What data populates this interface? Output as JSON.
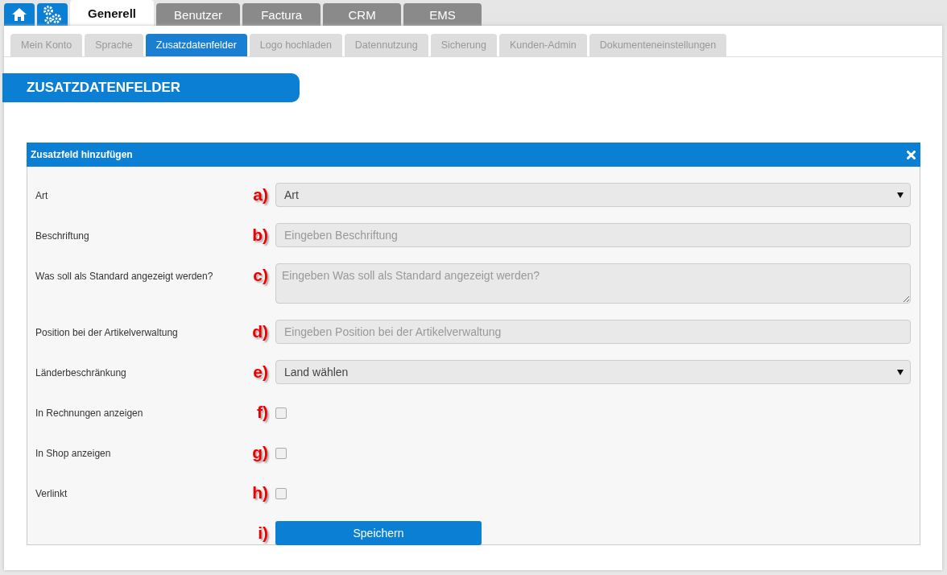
{
  "main_tabs": [
    {
      "kind": "home",
      "selected": false
    },
    {
      "kind": "settings",
      "selected": false
    },
    {
      "kind": "text",
      "label": "Generell",
      "selected": true
    },
    {
      "kind": "text",
      "label": "Benutzer",
      "selected": false
    },
    {
      "kind": "text",
      "label": "Factura",
      "selected": false
    },
    {
      "kind": "text",
      "label": "CRM",
      "selected": false
    },
    {
      "kind": "text",
      "label": "EMS",
      "selected": false
    }
  ],
  "sub_tabs": [
    {
      "label": "Mein Konto",
      "selected": false
    },
    {
      "label": "Sprache",
      "selected": false
    },
    {
      "label": "Zusatzdatenfelder",
      "selected": true
    },
    {
      "label": "Logo hochladen",
      "selected": false
    },
    {
      "label": "Datennutzung",
      "selected": false
    },
    {
      "label": "Sicherung",
      "selected": false
    },
    {
      "label": "Kunden-Admin",
      "selected": false
    },
    {
      "label": "Dokumenteneinstellungen",
      "selected": false
    }
  ],
  "section_title": "ZUSATZDATENFELDER",
  "dialog": {
    "title": "Zusatzfeld hinzufügen",
    "rows": [
      {
        "kind": "select",
        "label": "Art",
        "marker": "a)",
        "value": "Art"
      },
      {
        "kind": "input",
        "label": "Beschriftung",
        "marker": "b)",
        "placeholder": "Eingeben Beschriftung"
      },
      {
        "kind": "textarea",
        "label": "Was soll als Standard angezeigt werden?",
        "marker": "c)",
        "placeholder": "Eingeben Was soll als Standard angezeigt werden?"
      },
      {
        "kind": "input",
        "label": "Position bei der Artikelverwaltung",
        "marker": "d)",
        "placeholder": "Eingeben Position bei der Artikelverwaltung"
      },
      {
        "kind": "select",
        "label": "Länderbeschränkung",
        "marker": "e)",
        "value": "Land wählen"
      },
      {
        "kind": "checkbox",
        "label": "In Rechnungen anzeigen",
        "marker": "f)",
        "checked": false
      },
      {
        "kind": "checkbox",
        "label": "In Shop anzeigen",
        "marker": "g)",
        "checked": false
      },
      {
        "kind": "checkbox",
        "label": "Verlinkt",
        "marker": "h)",
        "checked": false
      },
      {
        "kind": "button",
        "marker": "i)",
        "label": "Speichern"
      }
    ]
  }
}
